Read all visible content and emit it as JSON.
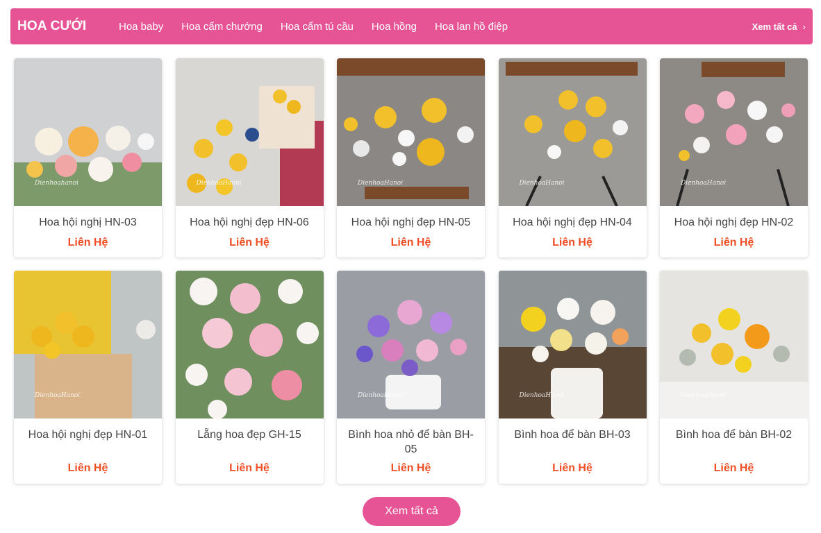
{
  "header": {
    "title": "HOA CƯỚI",
    "nav": [
      "Hoa baby",
      "Hoa cẩm chướng",
      "Hoa cẩm tú cầu",
      "Hoa hồng",
      "Hoa lan hồ điệp"
    ],
    "view_all": "Xem tất cả",
    "view_all_icon": "chevron-right-icon",
    "accent_color": "#e75495"
  },
  "products": [
    {
      "name": "Hoa hội nghị HN-03",
      "price": "Liên Hệ",
      "watermark": "Dienhoahanoi"
    },
    {
      "name": "Hoa hội nghị đẹp HN-06",
      "price": "Liên Hệ",
      "watermark": "DienhoaHanoi"
    },
    {
      "name": "Hoa hội nghị đẹp HN-05",
      "price": "Liên Hệ",
      "watermark": "DienhoaHanoi"
    },
    {
      "name": "Hoa hội nghị đẹp HN-04",
      "price": "Liên Hệ",
      "watermark": "DienhoaHanoi"
    },
    {
      "name": "Hoa hội nghị đẹp HN-02",
      "price": "Liên Hệ",
      "watermark": "DienhoaHanoi"
    },
    {
      "name": "Hoa hội nghị đẹp HN-01",
      "price": "Liên Hệ",
      "watermark": "DienhoaHanoi"
    },
    {
      "name": "Lẵng hoa đẹp GH-15",
      "price": "Liên Hệ",
      "watermark": ""
    },
    {
      "name": "Bình hoa nhỏ để bàn BH-05",
      "price": "Liên Hệ",
      "watermark": "DienhoaHanoi"
    },
    {
      "name": "Bình hoa để bàn BH-03",
      "price": "Liên Hệ",
      "watermark": "DienhoaHanoi"
    },
    {
      "name": "Bình hoa để bàn BH-02",
      "price": "Liên Hệ",
      "watermark": "DienhoaHanoi"
    }
  ],
  "footer": {
    "view_all_button": "Xem tất cả"
  },
  "colors": {
    "price": "#f04e24",
    "brand": "#e75495"
  }
}
